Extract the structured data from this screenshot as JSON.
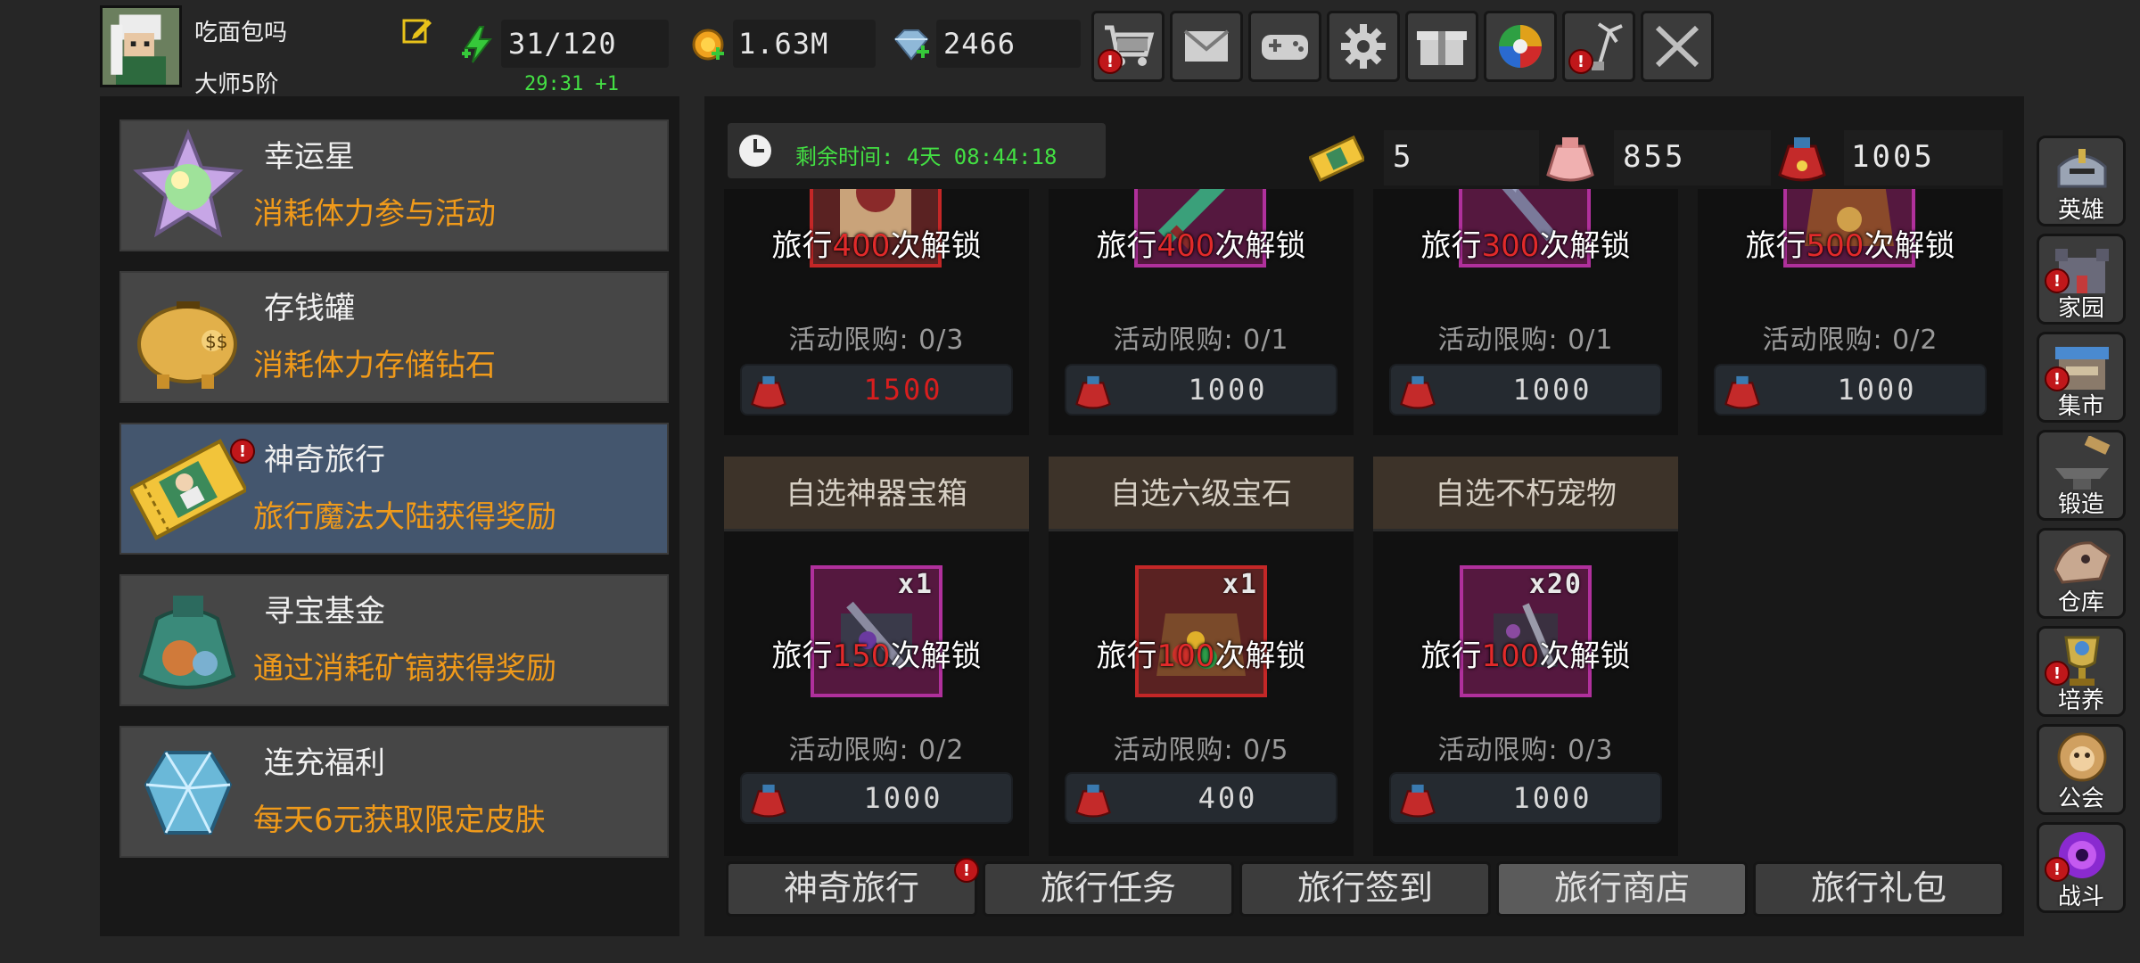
{
  "player": {
    "name": "吃面包吗",
    "rank": "大师5阶"
  },
  "stats": {
    "energy": "31/120",
    "energy_timer": "29:31 +1",
    "gold": "1.63M",
    "gems": "2466"
  },
  "toolbar": [
    {
      "icon": "shop-cart-icon",
      "alert": "!"
    },
    {
      "icon": "mail-icon",
      "alert": ""
    },
    {
      "icon": "gamepad-icon",
      "alert": ""
    },
    {
      "icon": "settings-gear-icon",
      "alert": ""
    },
    {
      "icon": "gift-icon",
      "alert": ""
    },
    {
      "icon": "color-wheel-icon",
      "alert": ""
    },
    {
      "icon": "fireworks-icon",
      "alert": "!"
    },
    {
      "icon": "crossed-swords-icon",
      "alert": ""
    }
  ],
  "activities": [
    {
      "title": "幸运星",
      "desc": "消耗体力参与活动",
      "icon": "lucky-star-icon"
    },
    {
      "title": "存钱罐",
      "desc": "消耗体力存储钻石",
      "icon": "piggy-bank-icon"
    },
    {
      "title": "神奇旅行",
      "desc": "旅行魔法大陆获得奖励",
      "icon": "travel-ticket-icon",
      "alert": "!"
    },
    {
      "title": "寻宝基金",
      "desc": "通过消耗矿镐获得奖励",
      "icon": "treasure-bag-icon"
    },
    {
      "title": "连充福利",
      "desc": "每天6元获取限定皮肤",
      "icon": "ice-crystal-icon"
    }
  ],
  "timer": {
    "label": "剩余时间: 4天 08:44:18"
  },
  "resources": [
    {
      "icon": "ticket-icon",
      "value": "5"
    },
    {
      "icon": "pink-bag-icon",
      "value": "855"
    },
    {
      "icon": "red-bag-icon",
      "value": "1005"
    }
  ],
  "shop_row1": [
    {
      "unlock_pre": "旅行",
      "unlock_num": "400",
      "unlock_post": "次解锁",
      "limit": "活动限购: 0/3",
      "price": "1500",
      "price_red": true
    },
    {
      "unlock_pre": "旅行",
      "unlock_num": "400",
      "unlock_post": "次解锁",
      "limit": "活动限购: 0/1",
      "price": "1000"
    },
    {
      "unlock_pre": "旅行",
      "unlock_num": "300",
      "unlock_post": "次解锁",
      "limit": "活动限购: 0/1",
      "price": "1000"
    },
    {
      "unlock_pre": "旅行",
      "unlock_num": "500",
      "unlock_post": "次解锁",
      "limit": "活动限购: 0/2",
      "price": "1000"
    }
  ],
  "shop_row2": [
    {
      "title": "自选神器宝箱",
      "count": "x1",
      "unlock_pre": "旅行",
      "unlock_num": "150",
      "unlock_post": "次解锁",
      "limit": "活动限购: 0/2",
      "price": "1000"
    },
    {
      "title": "自选六级宝石",
      "count": "x1",
      "unlock_pre": "旅行",
      "unlock_num": "100",
      "unlock_post": "次解锁",
      "limit": "活动限购: 0/5",
      "price": "400"
    },
    {
      "title": "自选不朽宠物",
      "count": "x20",
      "unlock_pre": "旅行",
      "unlock_num": "100",
      "unlock_post": "次解锁",
      "limit": "活动限购: 0/3",
      "price": "1000"
    }
  ],
  "tabs": [
    {
      "label": "神奇旅行",
      "alert": "!"
    },
    {
      "label": "旅行任务"
    },
    {
      "label": "旅行签到"
    },
    {
      "label": "旅行商店",
      "active": true
    },
    {
      "label": "旅行礼包"
    }
  ],
  "sidebar": [
    {
      "label": "英雄",
      "icon": "hero-helmet-icon"
    },
    {
      "label": "家园",
      "icon": "castle-icon",
      "alert": "!"
    },
    {
      "label": "集市",
      "icon": "market-stall-icon",
      "alert": "!"
    },
    {
      "label": "锻造",
      "icon": "anvil-hammer-icon"
    },
    {
      "label": "仓库",
      "icon": "dragon-skull-icon"
    },
    {
      "label": "培养",
      "icon": "trophy-cup-icon",
      "alert": "!"
    },
    {
      "label": "公会",
      "icon": "lion-emblem-icon"
    },
    {
      "label": "战斗",
      "icon": "purple-portal-icon",
      "alert": "!"
    }
  ]
}
